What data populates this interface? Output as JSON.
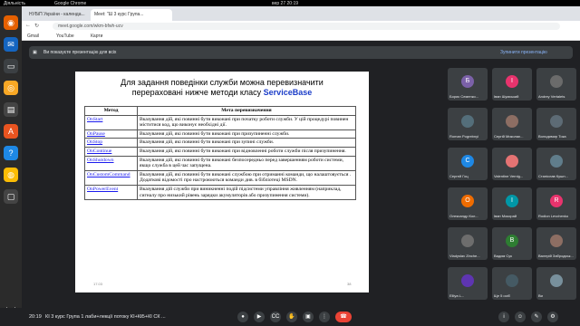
{
  "os_bar": {
    "left": "Діяльність",
    "app": "Google Chrome",
    "clock": "вер 27  20:19"
  },
  "tabs": [
    {
      "label": "НУБіП України - календа..."
    },
    {
      "label": "Meet: \"Ш 3 курс Група..."
    }
  ],
  "address": {
    "url": "meet.google.com/wkm-bfwh-ucv"
  },
  "bookmarks": [
    {
      "label": "Gmail"
    },
    {
      "label": "YouTube"
    },
    {
      "label": "Карти"
    }
  ],
  "banner": {
    "text": "Ви показуєте презентацію для всіх",
    "stop": "Зупинити презентацію"
  },
  "slide": {
    "title_line1": "Для задання поведінки служби можна перевизначити",
    "title_line2": "перераховані нижче методи класу",
    "title_class": "ServiceBase",
    "headers": [
      "Метод",
      "Мета перевизначення"
    ],
    "rows": [
      {
        "method": "OnStart",
        "desc": "Вказування дій, які повинні бути виконані при початку роботи служби. У цій процедурі повинен міститися код, що виконує необхідні дії."
      },
      {
        "method": "OnPause",
        "desc": "Вказування дій, які повинні бути виконані при призупиненні служби."
      },
      {
        "method": "OnStop",
        "desc": "Вказування дій, які повинні бути виконані при зупині служби."
      },
      {
        "method": "OnContinue",
        "desc": "Вказування дій, які повинні бути виконані при відновленні роботи служби після призупинення."
      },
      {
        "method": "OnShutdown",
        "desc": "Вказування дій, які повинні бути виконані безпосередньо перед завершенням роботи системи, якщо служба в цей час запущена."
      },
      {
        "method": "OnCustomCommand",
        "desc": "Вказування дій, які повинні бути виконані службою при отриманні команди, що налаштовується . Додаткові відомості про настроюються команди див. в бібліотеці MSDN."
      },
      {
        "method": "OnPowerEvent",
        "desc": "Вказування дій служби при виникненні подій підсистеми управління живленням (наприклад, сигналу про низький рівень зарядки акумуляторів або призупинення системи)."
      }
    ],
    "footer_left": "17.03",
    "footer_right": "38"
  },
  "participants": [
    {
      "name": "Борис Семенко...",
      "initial": "Б",
      "color": "#7b61a8"
    },
    {
      "name": "Іван Шумський",
      "initial": "І",
      "color": "#e8336d"
    },
    {
      "name": "Andrey Vertalets",
      "initial": "",
      "color": "#6b6b6b"
    },
    {
      "name": "Roman Pogrebnyi",
      "initial": "",
      "color": "#546e7a"
    },
    {
      "name": "Сергій Миколає...",
      "initial": "",
      "color": "#8d6e63"
    },
    {
      "name": "Володимир Тока",
      "initial": "",
      "color": "#5d6b75"
    },
    {
      "name": "Сергей Гоц",
      "initial": "С",
      "color": "#1e88e5"
    },
    {
      "name": "Valentine Vernig...",
      "initial": "",
      "color": "#e57373"
    },
    {
      "name": "Станіслав Кушн...",
      "initial": "",
      "color": "#607d8b"
    },
    {
      "name": "Олександр Кол...",
      "initial": "О",
      "color": "#ef6c00"
    },
    {
      "name": "Іван Мокорай",
      "initial": "І",
      "color": "#0097a7"
    },
    {
      "name": "Rodion Levchenko",
      "initial": "R",
      "color": "#e8336d"
    },
    {
      "name": "Vladyslav Zinche...",
      "initial": "",
      "color": "#6d6d6d"
    },
    {
      "name": "Вадим Сук",
      "initial": "В",
      "color": "#2e7d32"
    },
    {
      "name": "Валерій Забродськ...",
      "initial": "",
      "color": "#8d6e63"
    },
    {
      "name": "Elliya L...",
      "initial": "",
      "color": "#5e35b1"
    },
    {
      "name": "Ще 5 осіб",
      "initial": "",
      "color": "#455a64"
    },
    {
      "name": "Ви",
      "initial": "",
      "color": "#78909c"
    }
  ],
  "bottom": {
    "time": "20:19",
    "meeting": "КІ 3 курс Група 1 лаби+лекції потоку КІ+КіБ+КІ СК ..."
  }
}
